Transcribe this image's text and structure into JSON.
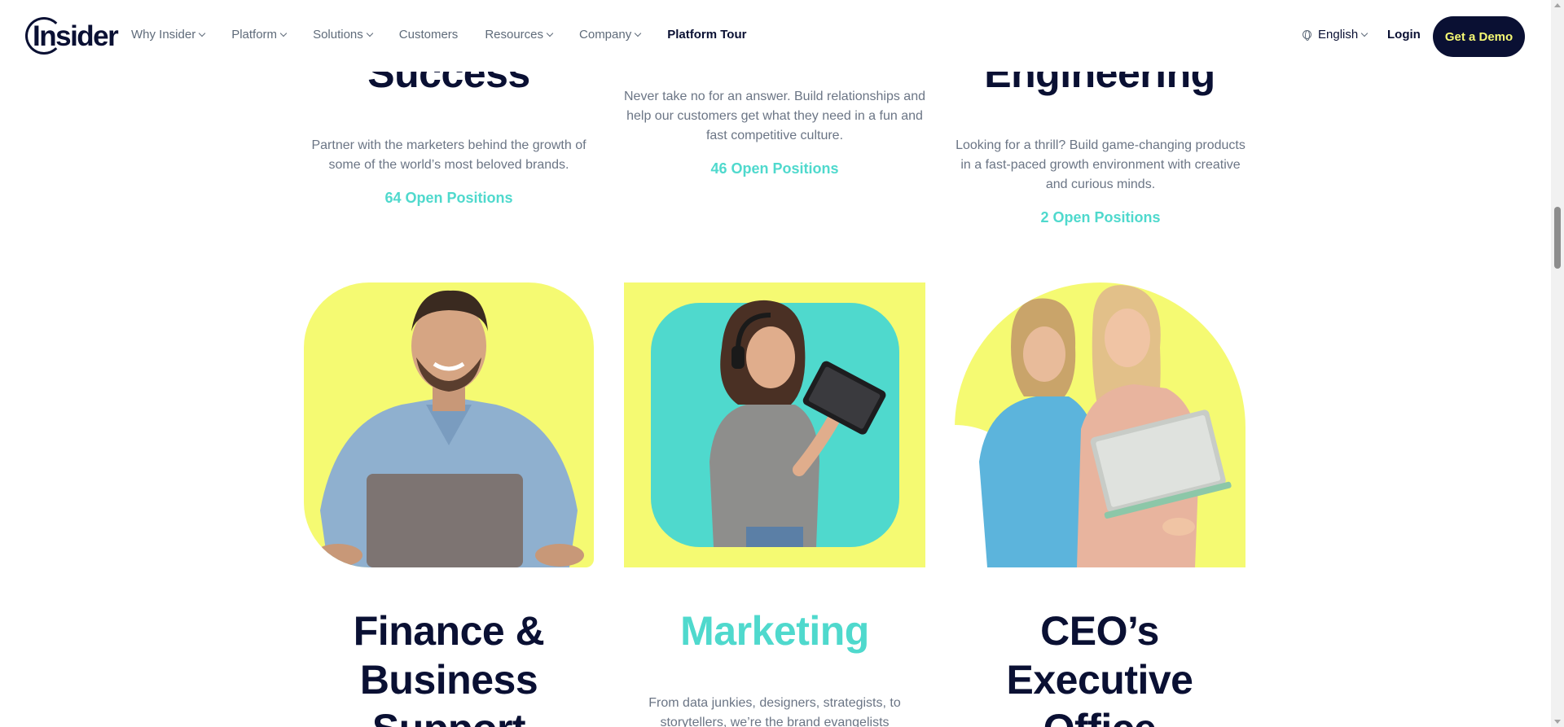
{
  "header": {
    "logo_text": "Insider",
    "nav": [
      {
        "label": "Why Insider",
        "dropdown": true
      },
      {
        "label": "Platform",
        "dropdown": true
      },
      {
        "label": "Solutions",
        "dropdown": true
      },
      {
        "label": "Customers",
        "dropdown": false
      },
      {
        "label": "Resources",
        "dropdown": true
      },
      {
        "label": "Company",
        "dropdown": true
      },
      {
        "label": "Platform Tour",
        "dropdown": false
      }
    ],
    "language": "English",
    "login": "Login",
    "cta": "Get a Demo"
  },
  "teams_top": [
    {
      "title": "Success",
      "desc": "Partner with the marketers behind the growth of some of the world’s most beloved brands.",
      "positions": "64 Open Positions"
    },
    {
      "title": "",
      "desc": "Never take no for an answer. Build relationships and help our customers get what they need in a fun and fast competitive culture.",
      "positions": "46 Open Positions"
    },
    {
      "title": "Engineering",
      "desc": "Looking for a thrill? Build game-changing products in a fast-paced growth environment with creative and curious minds.",
      "positions": "2 Open Positions"
    }
  ],
  "teams_bottom": [
    {
      "title": "Finance & Business Support",
      "title_lines": [
        "Finance &",
        "Business",
        "Support"
      ]
    },
    {
      "title": "Marketing",
      "desc": "From data junkies, designers, strategists, to storytellers, we’re the brand evangelists"
    },
    {
      "title": "CEO’s Executive Office",
      "title_lines": [
        "CEO’s",
        "Executive",
        "Office"
      ]
    }
  ],
  "colors": {
    "navy": "#0a1033",
    "teal": "#4fd9cd",
    "yellow": "#f5fa72"
  }
}
